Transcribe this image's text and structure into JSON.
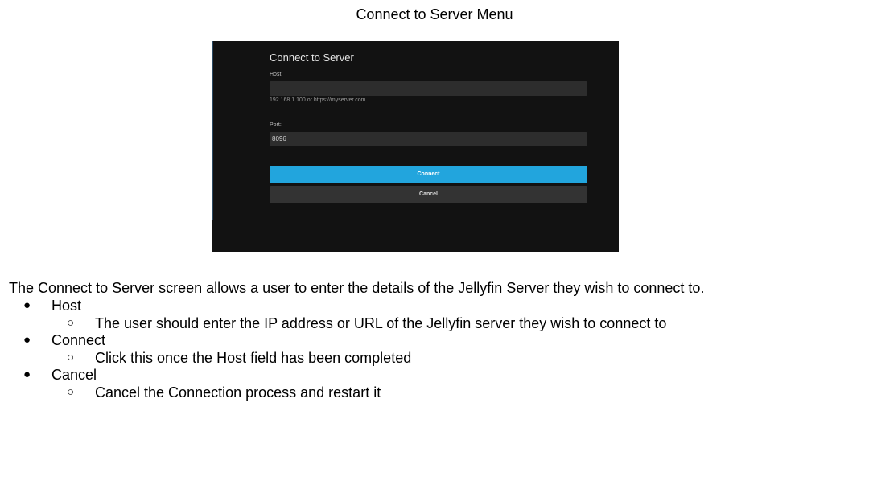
{
  "document": {
    "title": "Connect to Server Menu",
    "intro": "The Connect to Server screen allows a user to enter the details of the Jellyfin Server they wish to connect to.",
    "bullet_mark": "●",
    "sub_bullet_mark": "○",
    "items": [
      {
        "label": "Host",
        "detail": "The user should enter the IP address or URL of the Jellyfin server they wish to connect to"
      },
      {
        "label": "Connect",
        "detail": "Click this once the Host field has been completed"
      },
      {
        "label": "Cancel",
        "detail": "Cancel the Connection process and restart it"
      }
    ]
  },
  "dialog": {
    "title": "Connect to Server",
    "host_label": "Host:",
    "host_value": "",
    "host_hint": "192.168.1.100 or https://myserver.com",
    "port_label": "Port:",
    "port_value": "8096",
    "connect_label": "Connect",
    "cancel_label": "Cancel",
    "colors": {
      "background": "#121212",
      "field": "#2d2d2d",
      "connect": "#22a5dd",
      "cancel": "#333333"
    }
  }
}
